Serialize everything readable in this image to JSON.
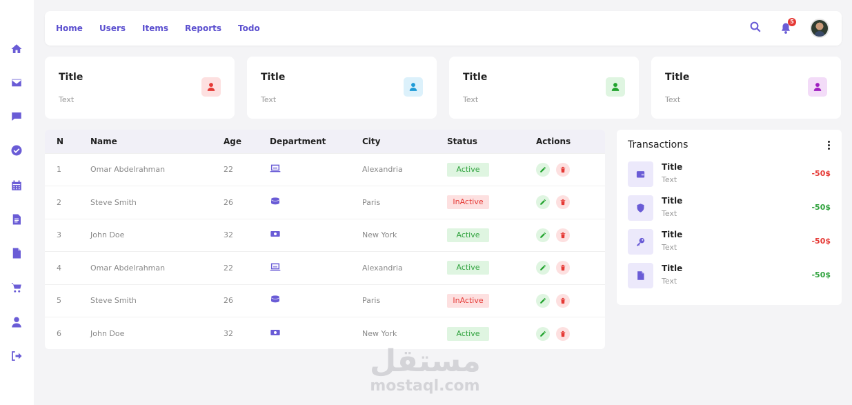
{
  "nav": {
    "links": [
      "Home",
      "Users",
      "Items",
      "Reports",
      "Todo"
    ],
    "notification_count": "5"
  },
  "sidebar": {
    "items": [
      "home-icon",
      "mail-icon",
      "chat-icon",
      "check-circle-icon",
      "calendar-icon",
      "document-list-icon",
      "file-icon",
      "cart-icon",
      "user-icon",
      "logout-icon"
    ]
  },
  "cards": [
    {
      "title": "Title",
      "text": "Text",
      "icon_color": "#e53935",
      "icon_bg": "#fde0e0"
    },
    {
      "title": "Title",
      "text": "Text",
      "icon_color": "#1e9bd7",
      "icon_bg": "#dcf1fb"
    },
    {
      "title": "Title",
      "text": "Text",
      "icon_color": "#22a32e",
      "icon_bg": "#dff5e1"
    },
    {
      "title": "Title",
      "text": "Text",
      "icon_color": "#a020c0",
      "icon_bg": "#f3dcf8"
    }
  ],
  "table": {
    "headers": [
      "N",
      "Name",
      "Age",
      "Department",
      "City",
      "Status",
      "Actions"
    ],
    "rows": [
      {
        "n": "1",
        "name": "Omar Abdelrahman",
        "age": "22",
        "dept_icon": "laptop-icon",
        "city": "Alexandria",
        "status": "Active"
      },
      {
        "n": "2",
        "name": "Steve Smith",
        "age": "26",
        "dept_icon": "database-icon",
        "city": "Paris",
        "status": "InActive"
      },
      {
        "n": "3",
        "name": "John Doe",
        "age": "32",
        "dept_icon": "money-icon",
        "city": "New York",
        "status": "Active"
      },
      {
        "n": "4",
        "name": "Omar Abdelrahman",
        "age": "22",
        "dept_icon": "laptop-icon",
        "city": "Alexandria",
        "status": "Active"
      },
      {
        "n": "5",
        "name": "Steve Smith",
        "age": "26",
        "dept_icon": "database-icon",
        "city": "Paris",
        "status": "InActive"
      },
      {
        "n": "6",
        "name": "John Doe",
        "age": "32",
        "dept_icon": "money-icon",
        "city": "New York",
        "status": "Active"
      }
    ]
  },
  "transactions": {
    "title": "Transactions",
    "items": [
      {
        "title": "Title",
        "text": "Text",
        "amount": "-50$",
        "icon": "wallet-icon",
        "color": "#e53935"
      },
      {
        "title": "Title",
        "text": "Text",
        "amount": "-50$",
        "icon": "shield-icon",
        "color": "#2fa23d"
      },
      {
        "title": "Title",
        "text": "Text",
        "amount": "-50$",
        "icon": "key-icon",
        "color": "#e53935"
      },
      {
        "title": "Title",
        "text": "Text",
        "amount": "-50$",
        "icon": "file-icon",
        "color": "#2fa23d"
      }
    ]
  },
  "watermark": {
    "arabic": "مستقل",
    "latin": "mostaql.com"
  },
  "colors": {
    "accent": "#6a5cd6",
    "active": "#2fa23d",
    "inactive": "#e53935"
  }
}
